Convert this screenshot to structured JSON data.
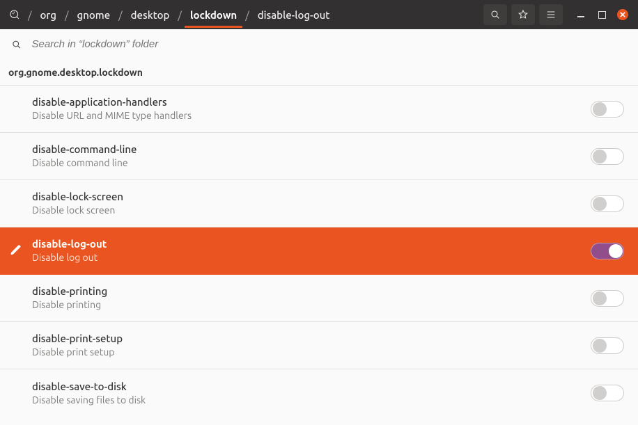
{
  "header": {
    "breadcrumbs": [
      "org",
      "gnome",
      "desktop",
      "lockdown",
      "disable-log-out"
    ],
    "active_crumb_index": 3
  },
  "search": {
    "placeholder": "Search in “lockdown” folder"
  },
  "section": {
    "schema_path": "org.gnome.desktop.lockdown"
  },
  "keys": [
    {
      "name": "disable-application-handlers",
      "summary": "Disable URL and MIME type handlers",
      "value": false,
      "selected": false
    },
    {
      "name": "disable-command-line",
      "summary": "Disable command line",
      "value": false,
      "selected": false
    },
    {
      "name": "disable-lock-screen",
      "summary": "Disable lock screen",
      "value": false,
      "selected": false
    },
    {
      "name": "disable-log-out",
      "summary": "Disable log out",
      "value": true,
      "selected": true
    },
    {
      "name": "disable-printing",
      "summary": "Disable printing",
      "value": false,
      "selected": false
    },
    {
      "name": "disable-print-setup",
      "summary": "Disable print setup",
      "value": false,
      "selected": false
    },
    {
      "name": "disable-save-to-disk",
      "summary": "Disable saving files to disk",
      "value": false,
      "selected": false
    }
  ]
}
